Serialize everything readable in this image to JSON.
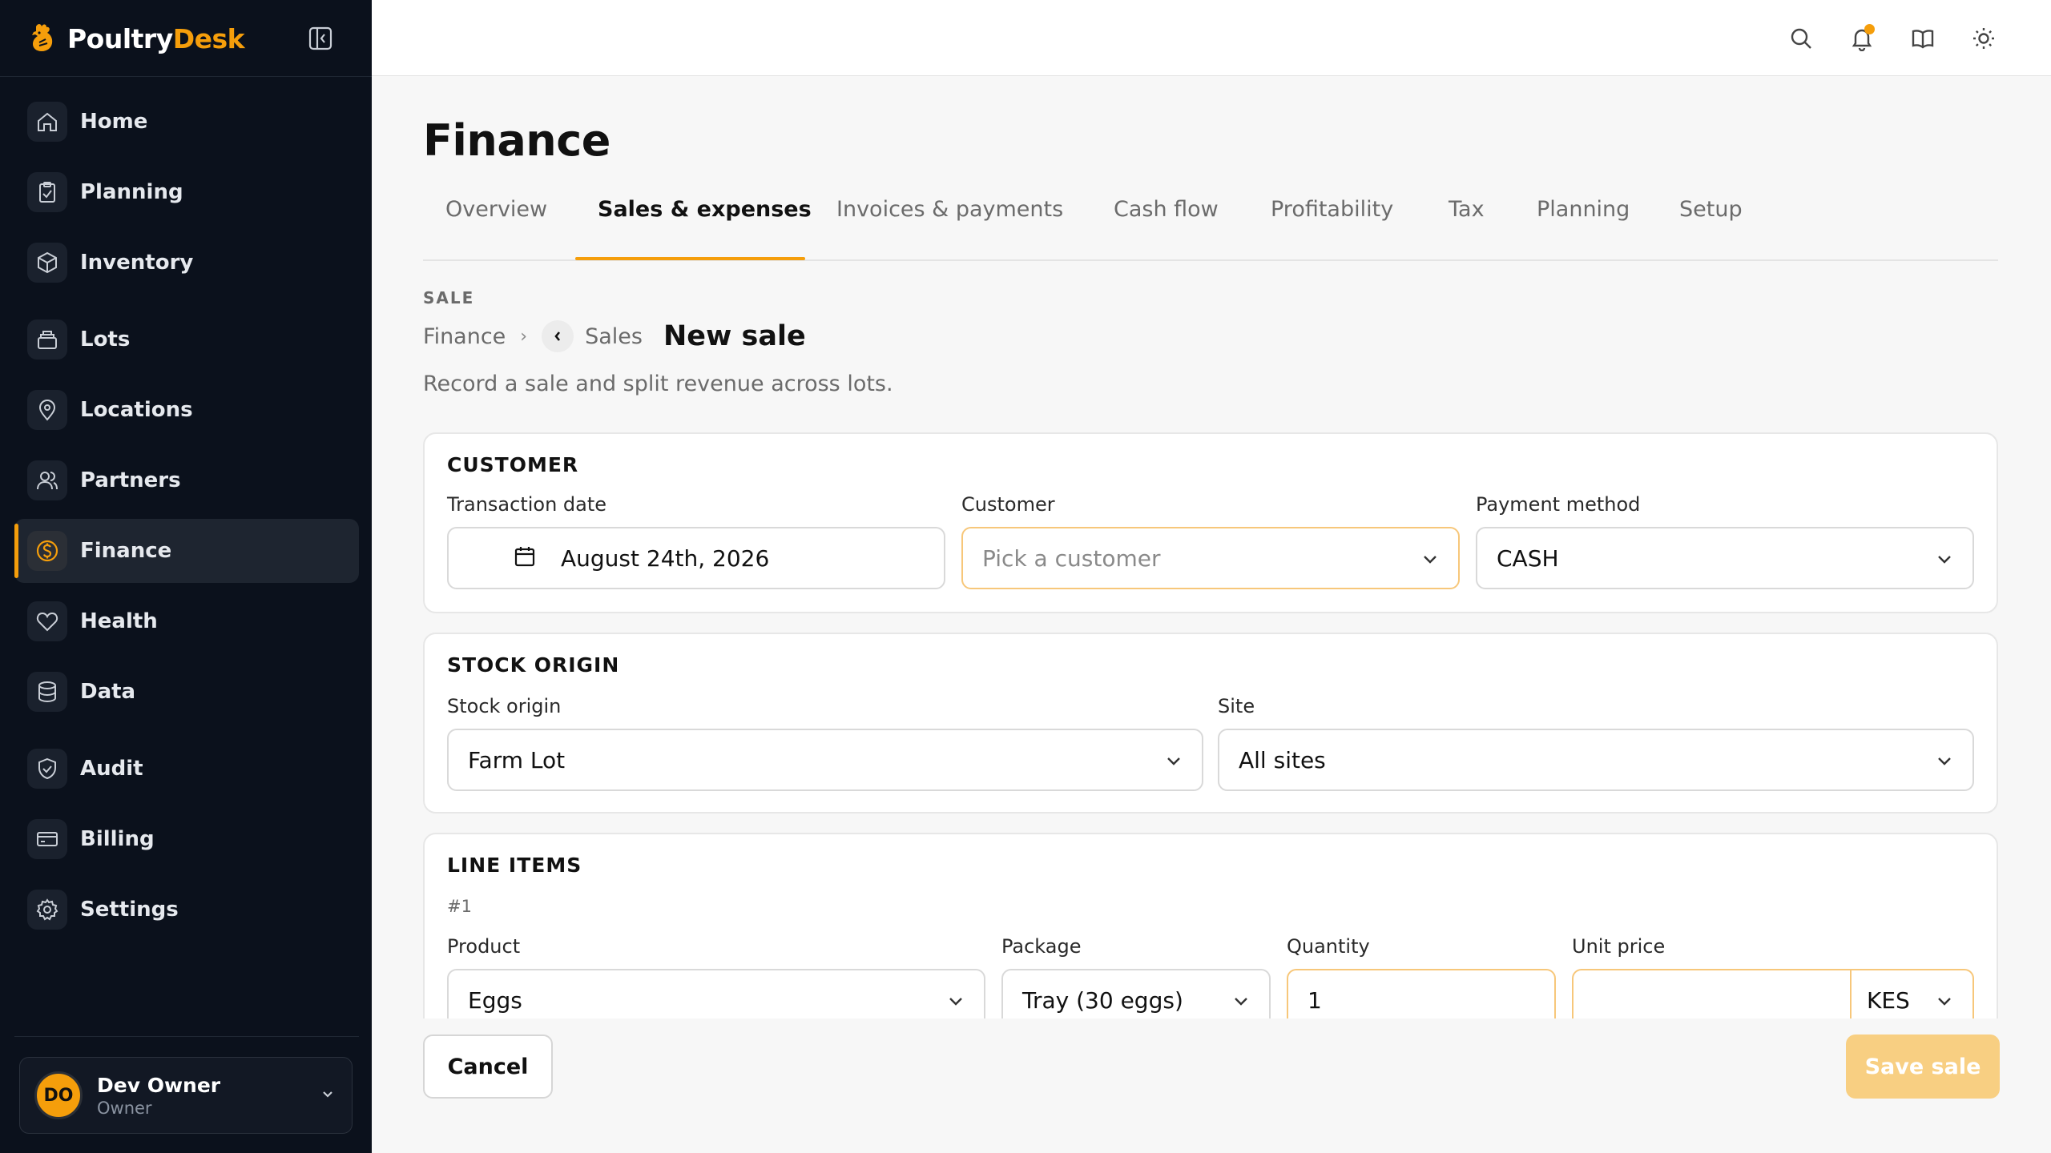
{
  "app": {
    "brand_primary": "Poultry",
    "brand_accent": "Desk",
    "accent_color": "#f59e0b"
  },
  "sidebar": {
    "items": [
      {
        "label": "Home",
        "icon": "home-icon"
      },
      {
        "label": "Planning",
        "icon": "clipboard-icon"
      },
      {
        "label": "Inventory",
        "icon": "box-icon"
      },
      {
        "label": "Lots",
        "icon": "lots-icon"
      },
      {
        "label": "Locations",
        "icon": "map-pin-icon"
      },
      {
        "label": "Partners",
        "icon": "users-icon"
      },
      {
        "label": "Finance",
        "icon": "dollar-circle-icon",
        "active": true
      },
      {
        "label": "Health",
        "icon": "heart-icon"
      },
      {
        "label": "Data",
        "icon": "database-icon"
      },
      {
        "label": "Audit",
        "icon": "shield-check-icon"
      },
      {
        "label": "Billing",
        "icon": "credit-card-icon"
      },
      {
        "label": "Settings",
        "icon": "gear-icon"
      }
    ],
    "user": {
      "initials": "DO",
      "name": "Dev Owner",
      "role": "Owner"
    }
  },
  "page": {
    "title": "Finance",
    "tabs": [
      {
        "label": "Overview"
      },
      {
        "label": "Sales & expenses",
        "active": true
      },
      {
        "label": "Invoices & payments"
      },
      {
        "label": "Cash flow"
      },
      {
        "label": "Profitability"
      },
      {
        "label": "Tax"
      },
      {
        "label": "Planning"
      },
      {
        "label": "Setup"
      }
    ],
    "eyebrow": "SALE",
    "breadcrumb": {
      "root": "Finance",
      "parent": "Sales",
      "current": "New sale"
    },
    "subtitle": "Record a sale and split revenue across lots."
  },
  "customer_section": {
    "title": "CUSTOMER",
    "transaction_date_label": "Transaction date",
    "transaction_date_value": "August 24th, 2026",
    "customer_label": "Customer",
    "customer_placeholder": "Pick a customer",
    "payment_label": "Payment method",
    "payment_value": "CASH"
  },
  "stock_section": {
    "title": "STOCK ORIGIN",
    "origin_label": "Stock origin",
    "origin_value": "Farm Lot",
    "site_label": "Site",
    "site_value": "All sites"
  },
  "line_items": {
    "title": "LINE ITEMS",
    "items": [
      {
        "number": "#1",
        "product_label": "Product",
        "product_value": "Eggs",
        "package_label": "Package",
        "package_value": "Tray (30 eggs)",
        "quantity_label": "Quantity",
        "quantity_value": "1",
        "unit_price_label": "Unit price",
        "unit_price_value": "",
        "currency_value": "KES"
      }
    ]
  },
  "footer": {
    "cancel_label": "Cancel",
    "save_label": "Save sale"
  }
}
